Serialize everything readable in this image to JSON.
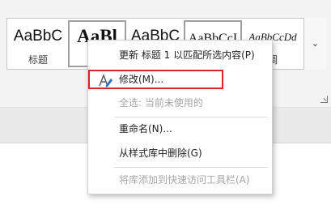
{
  "styles_gallery": {
    "swatches": [
      {
        "sample": "AaBbC",
        "name": "标题"
      },
      {
        "sample": "AaBl",
        "name": "标"
      },
      {
        "sample": "AaBbC",
        "name": ""
      },
      {
        "sample": "AaBbCcI",
        "name": ""
      },
      {
        "sample": "AaBbCcDd",
        "name": "调"
      }
    ],
    "scroll_icon": "chevron-down-icon",
    "launcher_icon": "dialog-launcher-icon"
  },
  "context_menu": {
    "items": [
      {
        "label": "更新 标题 1 以匹配所选内容(P)",
        "enabled": true
      },
      {
        "label": "修改(M)...",
        "enabled": true,
        "highlighted": true,
        "icon": "style-modify-icon"
      },
      {
        "label": "全选: 当前未使用的",
        "enabled": false
      },
      {
        "label": "重命名(N)...",
        "enabled": true
      },
      {
        "label": "从样式库中删除(G)",
        "enabled": true
      },
      {
        "label": "将库添加到快速访问工具栏(A)",
        "enabled": false
      }
    ]
  },
  "colors": {
    "highlight_border": "#d9242a",
    "icon_blue": "#2b6fc4"
  }
}
